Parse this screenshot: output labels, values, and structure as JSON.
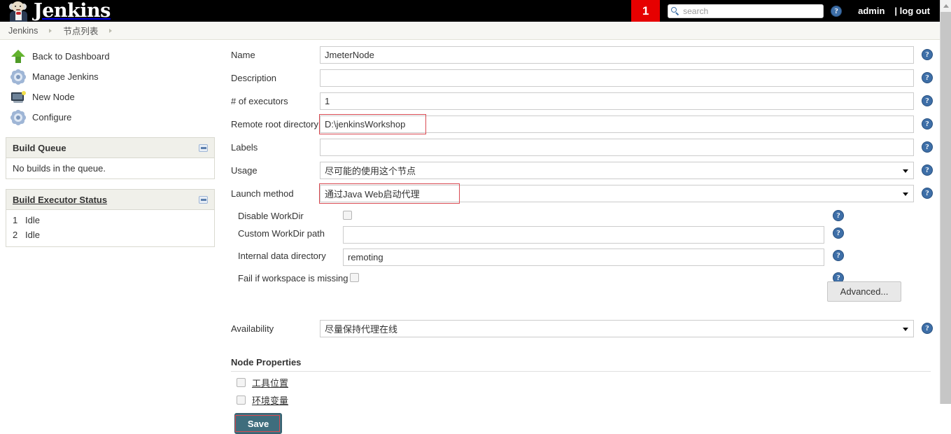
{
  "topbar": {
    "logo_text": "Jenkins",
    "alert_count": "1",
    "search_placeholder": "search",
    "search_value": "",
    "help_icon": "help-icon",
    "user_label": "admin",
    "logout_label": "| log out"
  },
  "breadcrumb": {
    "items": [
      {
        "label": "Jenkins"
      },
      {
        "label": "节点列表"
      }
    ]
  },
  "sidebar": {
    "links": [
      {
        "label": "Back to Dashboard",
        "icon": "up-arrow-icon"
      },
      {
        "label": "Manage Jenkins",
        "icon": "gear-icon"
      },
      {
        "label": "New Node",
        "icon": "computer-icon"
      },
      {
        "label": "Configure",
        "icon": "gear-icon"
      }
    ],
    "build_queue": {
      "title": "Build Queue",
      "empty_text": "No builds in the queue.",
      "collapse_icon": "minus-icon"
    },
    "build_executor": {
      "title": "Build Executor Status",
      "collapse_icon": "minus-icon",
      "executors": [
        {
          "num": "1",
          "state": "Idle"
        },
        {
          "num": "2",
          "state": "Idle"
        }
      ]
    }
  },
  "form": {
    "name": {
      "label": "Name",
      "value": "JmeterNode"
    },
    "description": {
      "label": "Description",
      "value": ""
    },
    "executors": {
      "label": "# of executors",
      "value": "1"
    },
    "remote_root": {
      "label": "Remote root directory",
      "value": "D:\\jenkinsWorkshop"
    },
    "labels": {
      "label": "Labels",
      "value": ""
    },
    "usage": {
      "label": "Usage",
      "value": "尽可能的使用这个节点"
    },
    "launch_method": {
      "label": "Launch method",
      "value": "通过Java Web启动代理"
    },
    "disable_workdir": {
      "label": "Disable WorkDir",
      "checked": false
    },
    "custom_workdir": {
      "label": "Custom WorkDir path",
      "value": ""
    },
    "internal_data_dir": {
      "label": "Internal data directory",
      "value": "remoting"
    },
    "fail_if_missing": {
      "label": "Fail if workspace is missing",
      "checked": false
    },
    "advanced_label": "Advanced...",
    "availability": {
      "label": "Availability",
      "value": "尽量保持代理在线"
    }
  },
  "node_properties": {
    "title": "Node Properties",
    "items": [
      {
        "label": "工具位置",
        "checked": false
      },
      {
        "label": "环境变量",
        "checked": false
      }
    ]
  },
  "actions": {
    "save_label": "Save"
  },
  "colors": {
    "topbar_bg": "#000000",
    "alert_red": "#e60000",
    "save_teal": "#3f6d7d",
    "annotation_red": "#d94a52",
    "help_blue": "#3e6fa8"
  }
}
